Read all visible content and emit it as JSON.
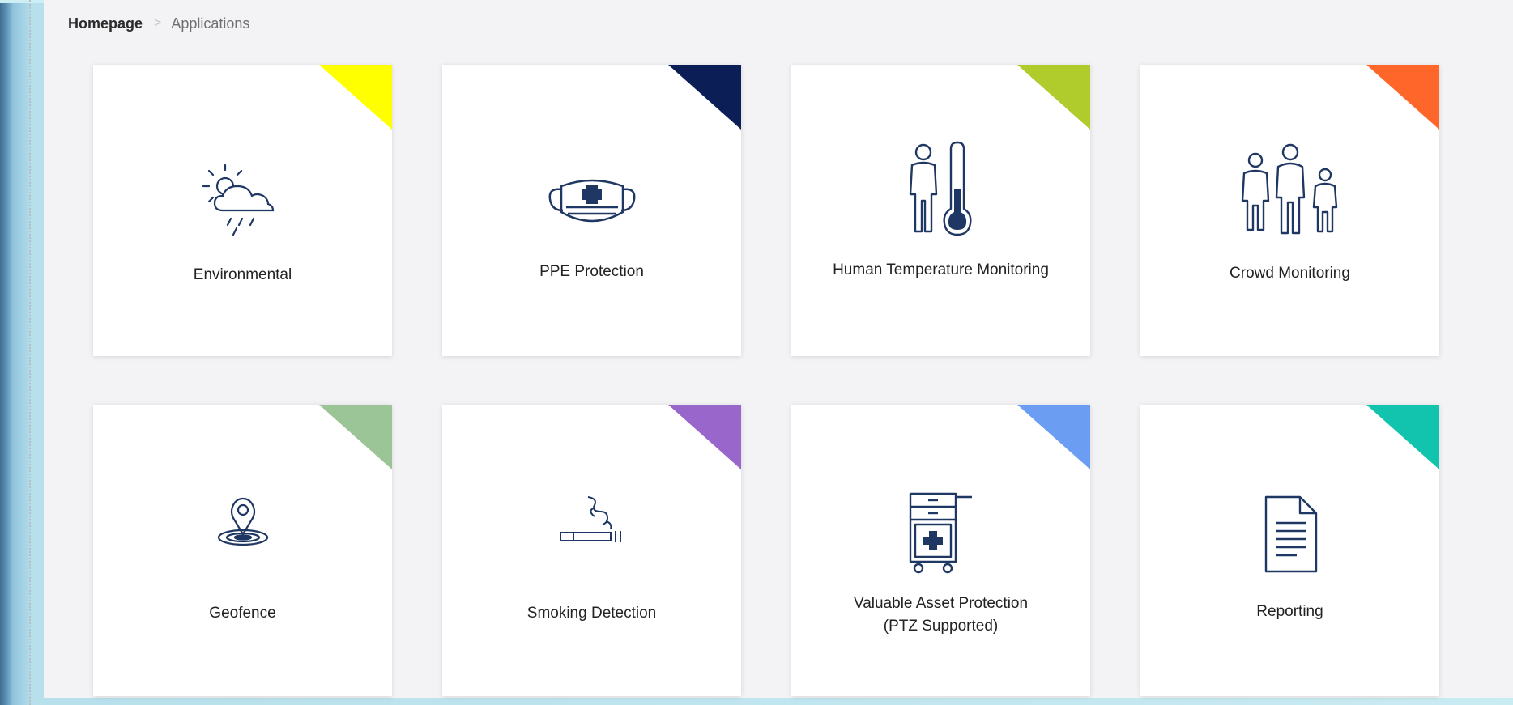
{
  "breadcrumb": {
    "home": "Homepage",
    "separator": ">",
    "current": "Applications"
  },
  "cards": [
    {
      "label": "Environmental",
      "icon": "weather-sun-cloud-rain-icon",
      "accent": "#ffff00"
    },
    {
      "label": "PPE Protection",
      "icon": "medical-mask-icon",
      "accent": "#0b1f56"
    },
    {
      "label": "Human Temperature Monitoring",
      "icon": "person-thermometer-icon",
      "accent": "#b0cb2c"
    },
    {
      "label": "Crowd Monitoring",
      "icon": "crowd-people-icon",
      "accent": "#ff6629"
    },
    {
      "label": "Geofence",
      "icon": "location-pin-icon",
      "accent": "#9bc596"
    },
    {
      "label": "Smoking Detection",
      "icon": "cigarette-smoke-icon",
      "accent": "#9966cc"
    },
    {
      "label": "Valuable Asset Protection\n(PTZ Supported)",
      "icon": "medical-cart-icon",
      "accent": "#6b9ef2"
    },
    {
      "label": "Reporting",
      "icon": "document-report-icon",
      "accent": "#12c4ae"
    }
  ]
}
